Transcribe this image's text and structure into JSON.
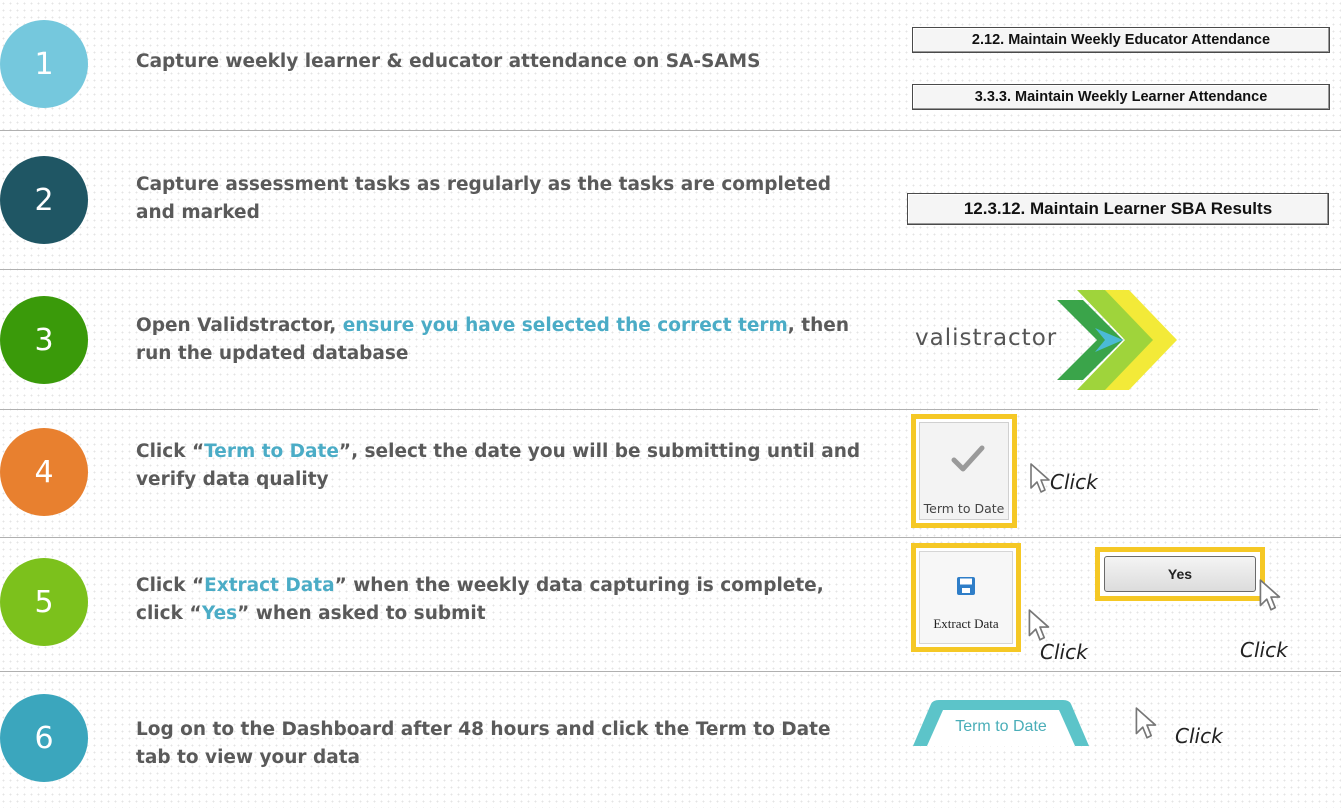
{
  "steps": [
    {
      "number": "1",
      "color": "#75c8dd",
      "text": "Capture weekly learner & educator attendance on SA-SAMS"
    },
    {
      "number": "2",
      "color": "#1f5664",
      "text": "Capture assessment tasks as regularly as the tasks are completed and marked"
    },
    {
      "number": "3",
      "color": "#3a9a0a",
      "text_before": "Open Validstractor, ",
      "text_highlight": "ensure you have selected the correct term",
      "text_after": ", then run the updated database"
    },
    {
      "number": "4",
      "color": "#e8802f",
      "text_before": "Click “",
      "text_highlight": "Term to Date",
      "text_after": "”, select the date you will be submitting until and verify data quality"
    },
    {
      "number": "5",
      "color": "#7cc11c",
      "text_before": "Click “",
      "text_highlight": "Extract Data",
      "text_middle": "” when the weekly data capturing is complete, click “",
      "text_highlight2": "Yes",
      "text_after": "” when asked to submit"
    },
    {
      "number": "6",
      "color": "#3ba6bd",
      "text": "Log on to the Dashboard after 48 hours and click the Term to Date tab to view your data"
    }
  ],
  "sams_buttons": {
    "educator_attendance": "2.12.  Maintain Weekly Educator Attendance",
    "learner_attendance": "3.3.3.  Maintain Weekly Learner Attendance",
    "sba_results": "12.3.12.  Maintain Learner SBA Results"
  },
  "valistractor": {
    "logo_text": "valistractor"
  },
  "term_to_date_button": {
    "label": "Term to Date",
    "icon": "checkmark-icon"
  },
  "extract_data_button": {
    "label": "Extract Data",
    "icon": "save-disk-icon"
  },
  "yes_button": {
    "label": "Yes"
  },
  "dashboard_tab": {
    "label": "Term to Date"
  },
  "click_label": "Click",
  "colors": {
    "highlight": "#4bacc6",
    "body_text": "#5a5a5a",
    "frame_yellow": "#f5c825",
    "tab_teal": "#5cc4c9"
  }
}
